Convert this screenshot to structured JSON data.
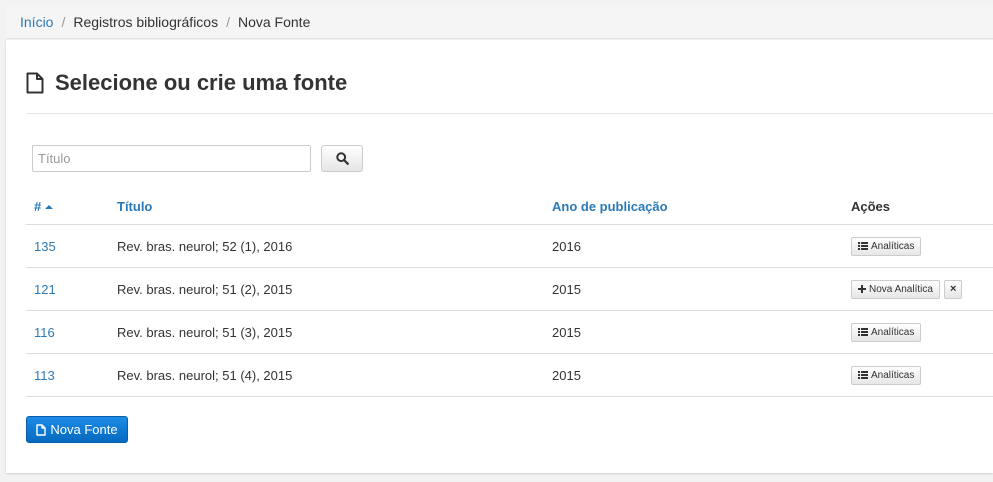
{
  "breadcrumb": {
    "home": "Início",
    "registros": "Registros bibliográficos",
    "current": "Nova Fonte"
  },
  "page": {
    "title": "Selecione ou crie uma fonte"
  },
  "search": {
    "placeholder": "Título",
    "icon": "search-icon"
  },
  "table": {
    "headers": {
      "id": "#",
      "titulo": "Título",
      "ano": "Ano de publicação",
      "acoes": "Ações"
    },
    "rows": [
      {
        "id": "135",
        "titulo": "Rev. bras. neurol; 52 (1), 2016",
        "ano": "2016",
        "action_label": "Analíticas"
      },
      {
        "id": "121",
        "titulo": "Rev. bras. neurol; 51 (2), 2015",
        "ano": "2015",
        "action_label": "Nova Analítica",
        "delete_label": "×"
      },
      {
        "id": "116",
        "titulo": "Rev. bras. neurol; 51 (3), 2015",
        "ano": "2015",
        "action_label": "Analíticas"
      },
      {
        "id": "113",
        "titulo": "Rev. bras. neurol; 51 (4), 2015",
        "ano": "2015",
        "action_label": "Analíticas"
      }
    ]
  },
  "new_button": {
    "label": "Nova Fonte"
  },
  "colors": {
    "link": "#2a7ab8",
    "primary": "#0569c0"
  }
}
